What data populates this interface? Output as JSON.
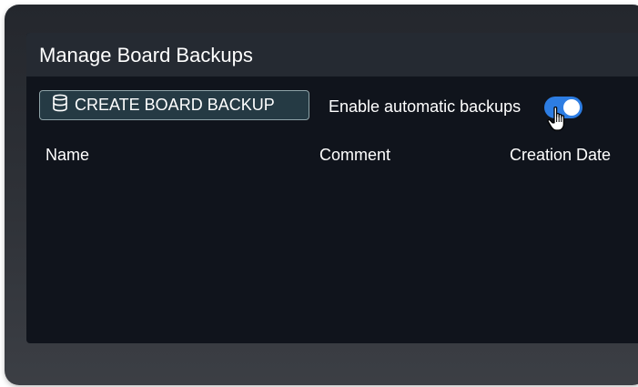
{
  "dialog": {
    "title": "Manage Board Backups"
  },
  "toolbar": {
    "create_button_label": "CREATE BOARD BACKUP",
    "create_button_icon": "database-icon",
    "auto_backup_label": "Enable automatic backups",
    "auto_backup_enabled": true
  },
  "table": {
    "columns": [
      "Name",
      "Comment",
      "Creation Date"
    ],
    "rows": []
  },
  "colors": {
    "panel_background": "#10141c",
    "header_background": "#252a32",
    "button_background": "#253a44",
    "button_border": "#8ea3a8",
    "toggle_on": "#2d7de3"
  }
}
